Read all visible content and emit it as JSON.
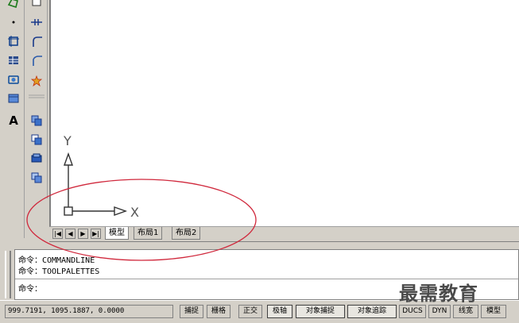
{
  "left_toolbar": {
    "icons": [
      "polygon-icon",
      "point-icon",
      "region-icon",
      "table-icon",
      "image-icon",
      "block-icon",
      "text-icon"
    ],
    "text_tool_label": "A"
  },
  "right_toolbar": {
    "icons": [
      "rectangle-icon",
      "trim-icon",
      "fillet-icon",
      "chamfer-icon",
      "explode-icon",
      "layer-copy-icon",
      "layer-move-icon",
      "layer-stack-icon",
      "layer-group-icon"
    ]
  },
  "ucs": {
    "y_label": "Y",
    "x_label": "X"
  },
  "tabs": {
    "nav": [
      "|◀",
      "◀",
      "▶",
      "▶|"
    ],
    "items": [
      {
        "label": "模型",
        "active": true
      },
      {
        "label": "布局1",
        "active": false
      },
      {
        "label": "布局2",
        "active": false
      }
    ]
  },
  "command": {
    "lines": [
      "命令：COMMANDLINE",
      "命令：TOOLPALETTES",
      "命令："
    ]
  },
  "status": {
    "coords": "999.7191,  1095.1887, 0.0000",
    "buttons": [
      {
        "label": "捕捉",
        "on": false
      },
      {
        "label": "栅格",
        "on": false
      },
      {
        "label": "正交",
        "on": false
      },
      {
        "label": "极轴",
        "on": true
      },
      {
        "label": "对象捕捉",
        "on": true
      },
      {
        "label": "对象追踪",
        "on": true
      },
      {
        "label": "DUCS",
        "on": false
      },
      {
        "label": "DYN",
        "on": false
      },
      {
        "label": "线宽",
        "on": false
      },
      {
        "label": "模型",
        "on": false
      }
    ]
  },
  "watermark": "最需教育",
  "annotation": {
    "color": "#d0283c"
  }
}
